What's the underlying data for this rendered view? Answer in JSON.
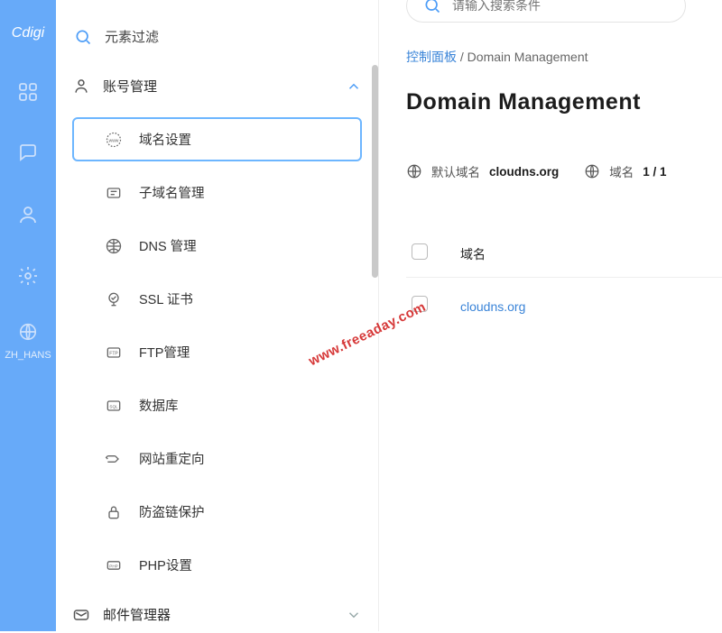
{
  "logo": "Cdigi",
  "rail_lang": "ZH_HANS",
  "sidebar": {
    "filter_label": "元素过滤",
    "sections": [
      {
        "title": "账号管理",
        "expanded": true,
        "items": [
          {
            "label": "域名设置",
            "active": true
          },
          {
            "label": "子域名管理"
          },
          {
            "label": "DNS 管理"
          },
          {
            "label": "SSL 证书"
          },
          {
            "label": "FTP管理"
          },
          {
            "label": "数据库"
          },
          {
            "label": "网站重定向"
          },
          {
            "label": "防盗链保护"
          },
          {
            "label": "PHP设置"
          }
        ]
      },
      {
        "title": "邮件管理器",
        "expanded": false
      }
    ]
  },
  "main": {
    "search_placeholder": "请输入搜索条件",
    "breadcrumb": {
      "root": "控制面板",
      "sep": " / ",
      "current": "Domain Management"
    },
    "title": "Domain Management",
    "stats": {
      "default_label": "默认域名",
      "default_value": "cloudns.org",
      "count_label": "域名",
      "count_value": "1 / 1"
    },
    "table": {
      "header_domain": "域名",
      "rows": [
        {
          "domain": "cloudns.org"
        }
      ]
    }
  },
  "watermark": "www.freeaday.com"
}
